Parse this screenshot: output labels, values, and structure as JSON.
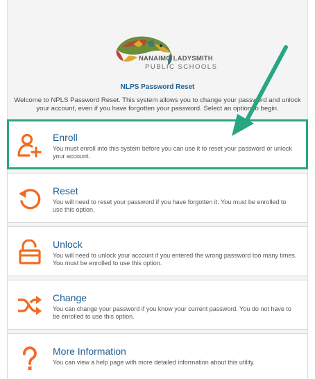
{
  "logo": {
    "line1": "NANAIMO LADYSMITH",
    "line2": "PUBLIC SCHOOLS",
    "icon": "salmon-logo-icon"
  },
  "page": {
    "title": "NLPS Password Reset",
    "intro": "Welcome to NPLS Password Reset. This system allows you to change your password and unlock your account, even if you have forgotten your password. Select an option to begin."
  },
  "options": [
    {
      "label": "Enroll",
      "description": "You must enroll into this system before you can use it to reset your password or unlock your account.",
      "icon": "user-add-icon"
    },
    {
      "label": "Reset",
      "description": "You will need to reset your password if you have forgotten it. You must be enrolled to use this option.",
      "icon": "reset-arrow-icon"
    },
    {
      "label": "Unlock",
      "description": "You will need to unlock your account if you entered the wrong password too many times. You must be enrolled to use this option.",
      "icon": "unlock-padlock-icon"
    },
    {
      "label": "Change",
      "description": "You can change your password if you know your current password. You do not have to be enrolled to use this option.",
      "icon": "shuffle-arrows-icon"
    },
    {
      "label": "More Information",
      "description": "You can view a help page with more detailed information about this utility.",
      "icon": "question-mark-icon"
    }
  ],
  "colors": {
    "icon": "#f26b21",
    "highlight": "#2aa583",
    "link": "#1e5d93"
  }
}
